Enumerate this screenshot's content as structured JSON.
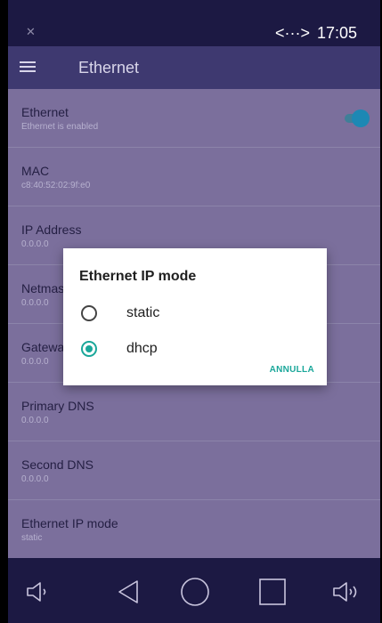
{
  "status_bar": {
    "signal_icon": "no-signal-icon",
    "ethernet_icon": "<···>",
    "time": "17:05"
  },
  "app_bar": {
    "title": "Ethernet",
    "menu_icon": "menu-icon"
  },
  "settings": [
    {
      "title": "Ethernet",
      "subtitle": "Ethernet is enabled",
      "toggle_on": true
    },
    {
      "title": "MAC",
      "subtitle": "c8:40:52:02:9f:e0"
    },
    {
      "title": "IP Address",
      "subtitle": "0.0.0.0"
    },
    {
      "title": "Netmask",
      "subtitle": "0.0.0.0"
    },
    {
      "title": "Gateway",
      "subtitle": "0.0.0.0"
    },
    {
      "title": "Primary DNS",
      "subtitle": "0.0.0.0"
    },
    {
      "title": "Second DNS",
      "subtitle": "0.0.0.0"
    },
    {
      "title": "Ethernet IP mode",
      "subtitle": "static"
    }
  ],
  "dialog": {
    "title": "Ethernet IP mode",
    "options": [
      {
        "label": "static",
        "selected": false
      },
      {
        "label": "dhcp",
        "selected": true
      }
    ],
    "cancel_label": "ANNULLA"
  },
  "nav_bar": {
    "icons": [
      "volume-down-icon",
      "back-icon",
      "home-icon",
      "recents-icon",
      "volume-up-icon"
    ]
  },
  "colors": {
    "accent": "#1aa79a",
    "toggle": "#1d88b4",
    "status_bar": "#1c1943",
    "app_bar": "#3e3970"
  }
}
